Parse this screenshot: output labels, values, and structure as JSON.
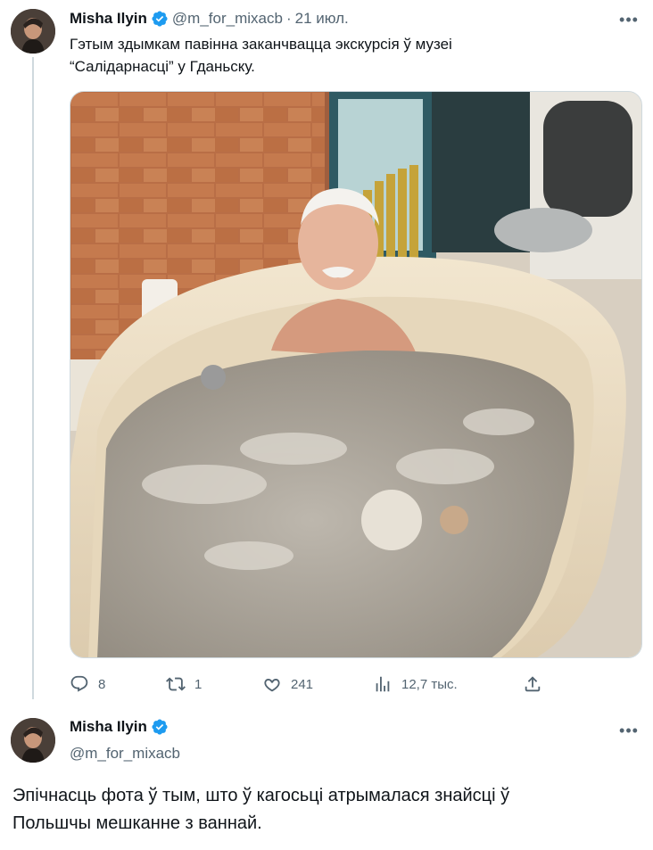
{
  "tweet1": {
    "author_name": "Misha Ilyin",
    "handle": "@m_for_mixacb",
    "separator": "·",
    "date": "21 июл.",
    "text_line1": "Гэтым здымкам павінна заканчвацца экскурсія ў музеі",
    "text_line2": "“Салідарнасці” у Гданьску.",
    "more_label": "•••",
    "actions": {
      "replies": "8",
      "retweets": "1",
      "likes": "241",
      "views": "12,7 тыс."
    }
  },
  "tweet2": {
    "author_name": "Misha Ilyin",
    "handle": "@m_for_mixacb",
    "more_label": "•••",
    "text_line1": "Эпічнасць фота ў тым, што ў кагосьці атрымалася знайсці ў",
    "text_line2": "Польшчы мешканне з ваннай."
  },
  "colors": {
    "verified": "#1d9bf0",
    "secondary_text": "#536471",
    "thread_line": "#cfd9de"
  },
  "icons": [
    "verified-badge-icon",
    "reply-icon",
    "retweet-icon",
    "like-icon",
    "views-icon",
    "share-icon",
    "more-icon"
  ]
}
